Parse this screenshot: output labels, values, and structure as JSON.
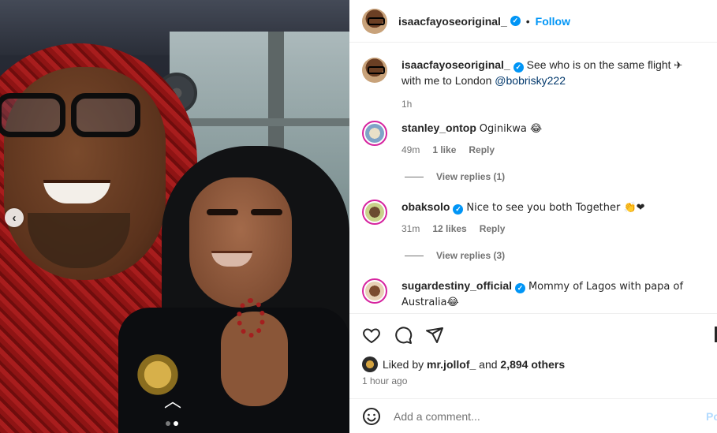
{
  "post": {
    "author": "isaacfayoseoriginal_",
    "follow_label": "Follow",
    "caption": {
      "username": "isaacfayoseoriginal_",
      "text_before": "See who is on the same flight",
      "text_after": "with me to London",
      "mention": "@bobrisky222",
      "flight_emoji": "✈",
      "age": "1h"
    },
    "comments": [
      {
        "username": "stanley_ontop",
        "verified": false,
        "text": "Oginikwa 😂",
        "age": "49m",
        "likes": "1 like",
        "reply": "Reply",
        "view_replies": "View replies (1)"
      },
      {
        "username": "obaksolo",
        "verified": true,
        "text": "Nice to see you both Together 👏❤",
        "age": "31m",
        "likes": "12 likes",
        "reply": "Reply",
        "view_replies": "View replies (3)"
      },
      {
        "username": "sugardestiny_official",
        "verified": true,
        "text": "Mommy of Lagos with papa of Australia😂"
      }
    ],
    "liked_by": {
      "prefix": "Liked by",
      "user": "mr.jollof_",
      "middle": "and",
      "others": "2,894 others"
    },
    "timestamp": "1 hour ago",
    "add_comment_placeholder": "Add a comment...",
    "post_label": "Post"
  },
  "colors": {
    "accent": "#0095f6",
    "verified": "#0095f6",
    "secondary_text": "#737373"
  },
  "icons": [
    "heart-icon",
    "comment-icon",
    "share-icon",
    "emoji-icon",
    "chevron-left-icon",
    "chevron-up-icon",
    "verified-badge-icon"
  ]
}
